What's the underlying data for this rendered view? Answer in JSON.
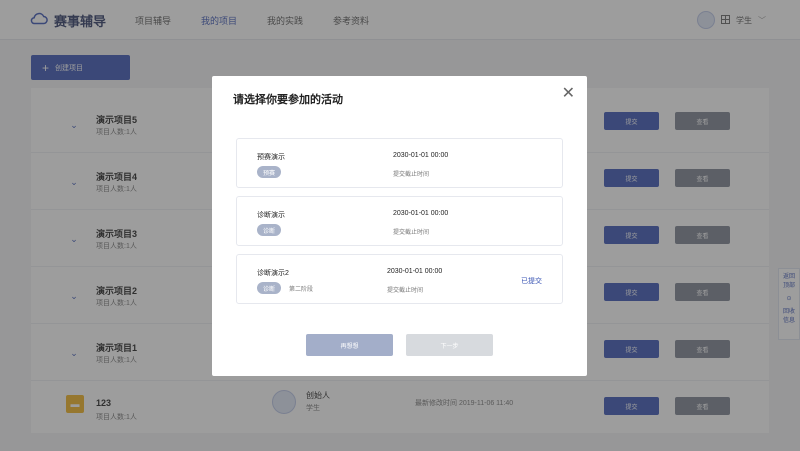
{
  "app": {
    "name": "赛事辅导"
  },
  "nav": [
    {
      "label": "项目辅导"
    },
    {
      "label": "我的项目"
    },
    {
      "label": "我的实践"
    },
    {
      "label": "参考资料"
    }
  ],
  "user": {
    "role": "学生"
  },
  "create_button": {
    "label": "创建项目"
  },
  "projects": [
    {
      "name": "演示项目5",
      "members": "项目人数:1人"
    },
    {
      "name": "演示项目4",
      "members": "项目人数:1人"
    },
    {
      "name": "演示项目3",
      "members": "项目人数:1人"
    },
    {
      "name": "演示项目2",
      "members": "项目人数:1人"
    },
    {
      "name": "演示项目1",
      "members": "项目人数:1人"
    },
    {
      "name": "123",
      "members": "项目人数:1人",
      "creator_name": "创始人",
      "creator_role": "学生",
      "modified": "最新修改时间 2019-11-06 11:40"
    }
  ],
  "row_buttons": {
    "submit": "提交",
    "view": "查看"
  },
  "side_tab": {
    "line1": "返回",
    "line2": "顶部",
    "line3": "回收",
    "line4": "信息"
  },
  "modal": {
    "title": "请选择你要参加的活动",
    "activities": [
      {
        "name": "预赛演示",
        "tag": "预赛",
        "round": "",
        "date": "2030-01-01 00:00",
        "deadline": "提交截止时间",
        "status": ""
      },
      {
        "name": "诊断演示",
        "tag": "诊断",
        "round": "",
        "date": "2030-01-01 00:00",
        "deadline": "提交截止时间",
        "status": ""
      },
      {
        "name": "诊断演示2",
        "tag": "诊断",
        "round": "第二阶段",
        "date": "2030-01-01 00:00",
        "deadline": "提交截止时间",
        "status": "已提交"
      }
    ],
    "back_label": "再想想",
    "next_label": "下一步"
  }
}
